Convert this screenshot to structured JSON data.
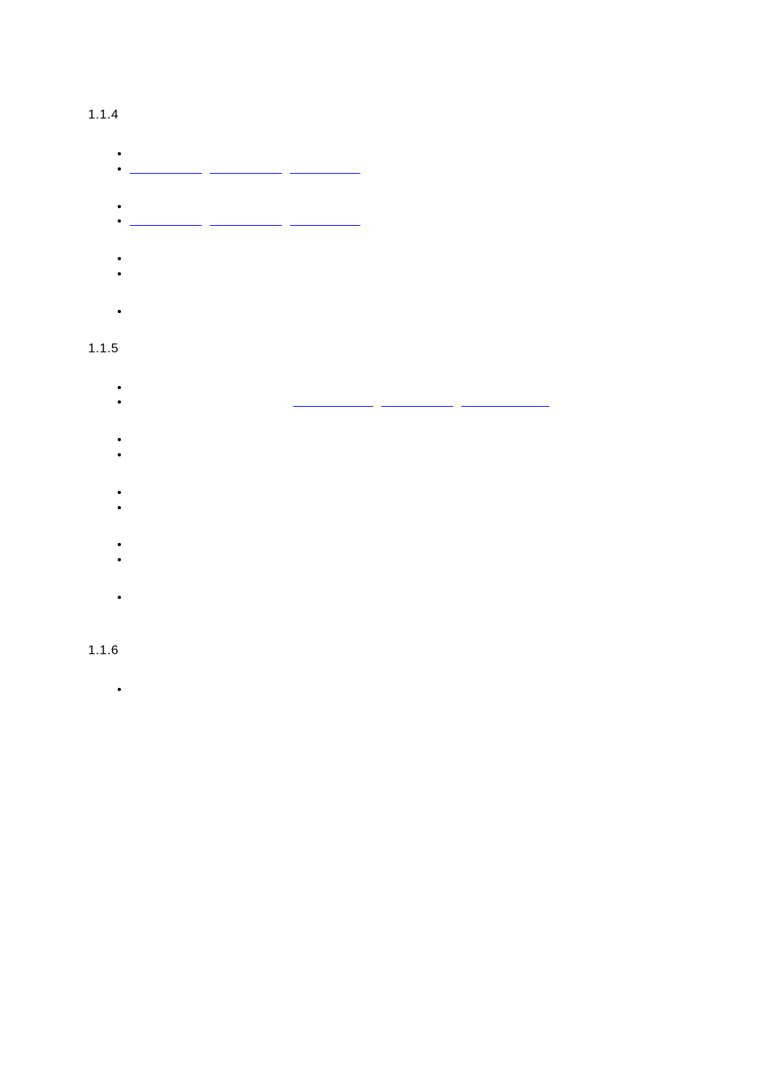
{
  "sections": [
    {
      "number": "1.1.4",
      "groups": [
        {
          "bullets": [
            {
              "text": "",
              "linkSegments": null
            },
            {
              "text": "",
              "linkSegments": [
                90,
                90,
                88
              ]
            }
          ]
        },
        {
          "bullets": [
            {
              "text": "",
              "linkSegments": null
            },
            {
              "text": "",
              "linkSegments": [
                90,
                90,
                88
              ]
            }
          ]
        },
        {
          "bullets": [
            {
              "text": "",
              "linkSegments": null
            },
            {
              "text": "",
              "linkSegments": null
            }
          ]
        },
        {
          "bullets": [
            {
              "text": "",
              "linkSegments": null
            }
          ]
        }
      ]
    },
    {
      "number": "1.1.5",
      "groups": [
        {
          "bullets": [
            {
              "text": "",
              "linkSegments": null
            },
            {
              "text": "",
              "linkLeadGap": 200,
              "linkSegments": [
                100,
                90,
                110
              ]
            }
          ]
        },
        {
          "bullets": [
            {
              "text": "",
              "linkSegments": null
            },
            {
              "text": "",
              "linkSegments": null
            }
          ]
        },
        {
          "bullets": [
            {
              "text": "",
              "linkSegments": null
            },
            {
              "text": "",
              "linkSegments": null
            }
          ]
        },
        {
          "bullets": [
            {
              "text": "",
              "linkSegments": null
            },
            {
              "text": "",
              "linkSegments": null
            }
          ]
        },
        {
          "bullets": [
            {
              "text": "",
              "linkSegments": null
            }
          ]
        }
      ]
    },
    {
      "number": "1.1.6",
      "groups": [
        {
          "bullets": [
            {
              "text": "",
              "linkSegments": null
            }
          ]
        }
      ]
    }
  ]
}
